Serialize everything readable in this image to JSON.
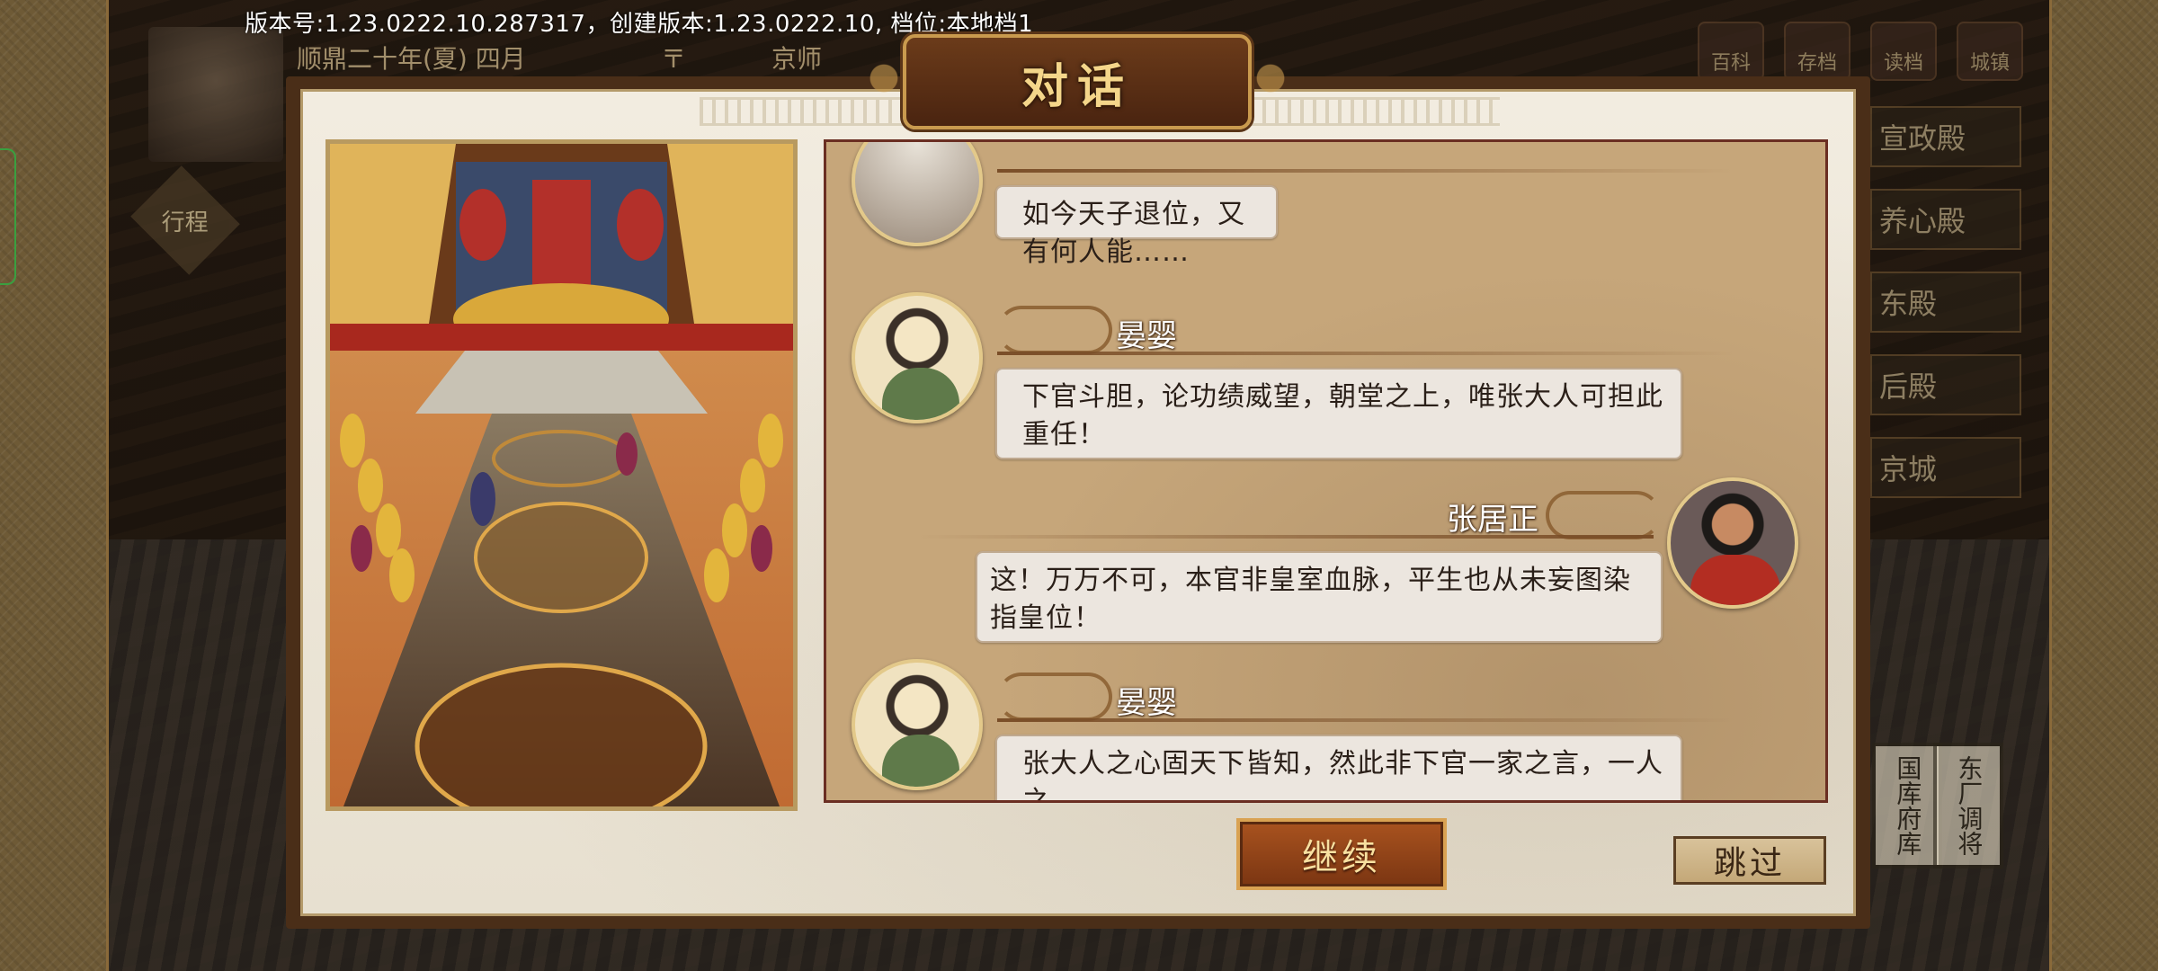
{
  "version_bar": {
    "text": "版本号:1.23.0222.10.287317，创建版本:1.23.0222.10, 档位:本地档1"
  },
  "background_hud": {
    "date": "顺鼎二十年(夏) 四月",
    "city": "京师",
    "side_label": "行程",
    "top_icons": [
      "百科",
      "存档",
      "读档",
      "城镇"
    ],
    "right_menu": [
      "宣政殿",
      "养心殿",
      "东殿",
      "后殿",
      "京城"
    ],
    "vertical_buttons": [
      "国库府库",
      "东厂调将"
    ]
  },
  "dialog": {
    "title": "对话",
    "messages": [
      {
        "speaker": "",
        "side": "left",
        "avatar": "unknown-portrait",
        "text": "如今天子退位，又有何人能……"
      },
      {
        "speaker": "晏婴",
        "side": "left",
        "avatar": "yan-ying-portrait",
        "text": "下官斗胆，论功绩威望，朝堂之上，唯张大人可担此重任！"
      },
      {
        "speaker": "张居正",
        "side": "right",
        "avatar": "zhang-juzheng-portrait",
        "text": "这！万万不可，本官非皇室血脉，平生也从未妄图染指皇位！"
      },
      {
        "speaker": "晏婴",
        "side": "left",
        "avatar": "yan-ying-portrait",
        "text": "张大人之心固天下皆知，然此非下官一家之言，一人之"
      }
    ],
    "continue_label": "继续",
    "skip_label": "跳过"
  },
  "colors": {
    "dialog_frame": "#4a2e18",
    "parchment": "#f2ece0",
    "chat_panel": "#c6a67a",
    "bubble": "#ece6df",
    "title_gold": "#f4d68a",
    "continue_button": "#a9531f"
  }
}
